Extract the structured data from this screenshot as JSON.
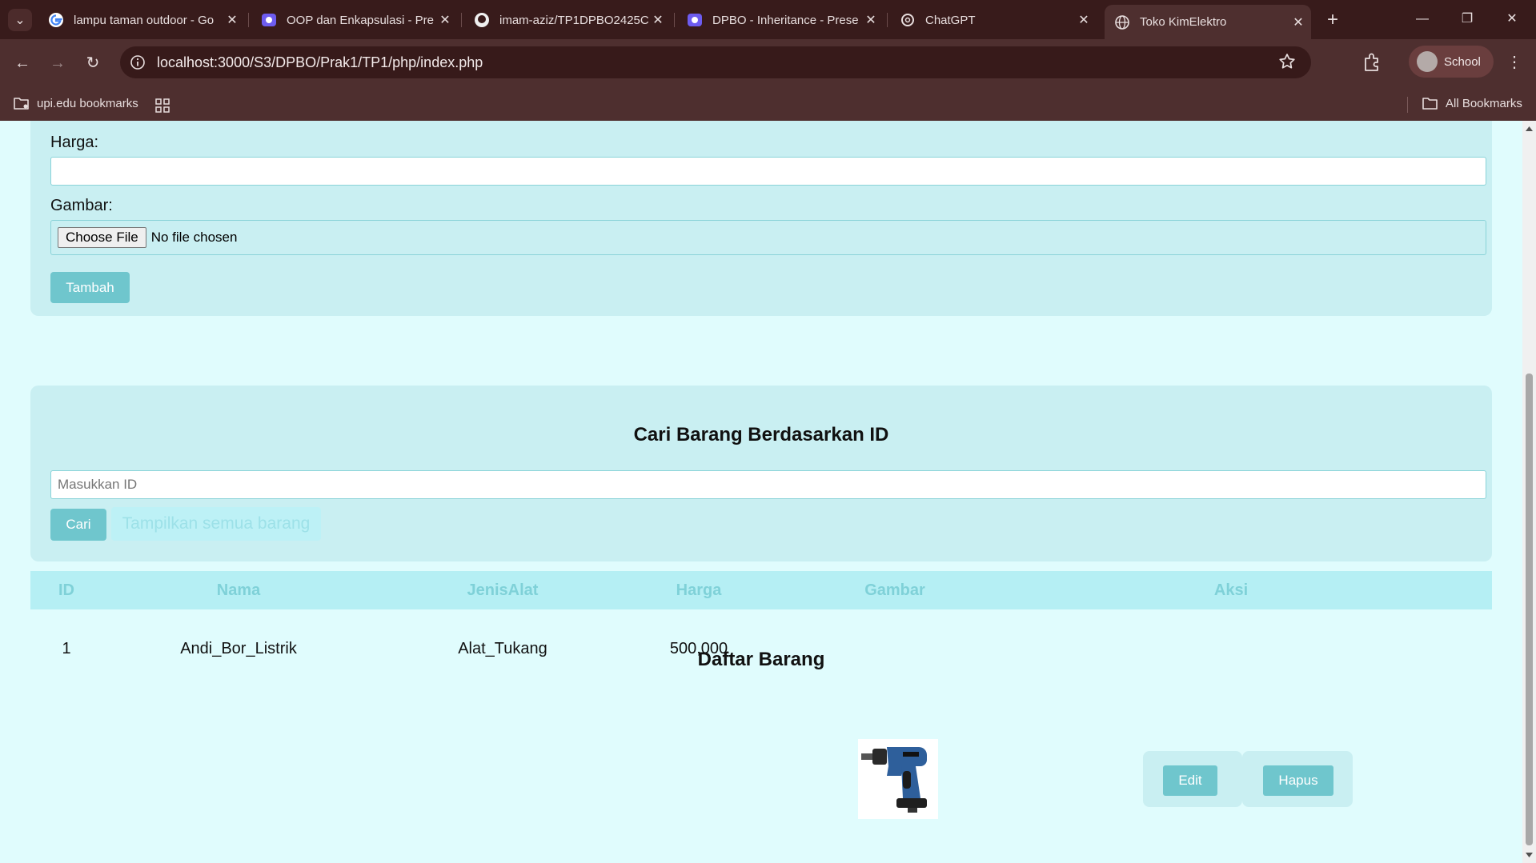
{
  "browser": {
    "tabs": [
      {
        "title": "lampu taman outdoor - Go",
        "icon": "google-icon",
        "active": false
      },
      {
        "title": "OOP dan Enkapsulasi - Pre",
        "icon": "presentation-icon",
        "active": false
      },
      {
        "title": "imam-aziz/TP1DPBO2425C",
        "icon": "github-icon",
        "active": false
      },
      {
        "title": "DPBO - Inheritance - Prese",
        "icon": "presentation-icon",
        "active": false
      },
      {
        "title": "ChatGPT",
        "icon": "chatgpt-icon",
        "active": false
      },
      {
        "title": "Toko KimElektro",
        "icon": "globe-icon",
        "active": true
      }
    ],
    "url": "localhost:3000/S3/DPBO/Prak1/TP1/php/index.php",
    "profile_label": "School",
    "bookmarks_left": "upi.edu bookmarks",
    "bookmarks_right": "All Bookmarks",
    "tab_close_glyph": "✕",
    "new_tab_glyph": "+",
    "minimize_glyph": "—",
    "restore_glyph": "❐",
    "close_glyph": "✕",
    "back_glyph": "←",
    "forward_glyph": "→",
    "reload_glyph": "↻",
    "menu_glyph": "⋮",
    "tab_menu_glyph": "⌄"
  },
  "form": {
    "harga_label": "Harga:",
    "harga_value": "",
    "gambar_label": "Gambar:",
    "file_button": "Choose File",
    "file_status": "No file chosen",
    "submit_label": "Tambah"
  },
  "search": {
    "title": "Cari Barang Berdasarkan ID",
    "placeholder": "Masukkan ID",
    "search_button": "Cari",
    "show_all_button": "Tampilkan semua barang"
  },
  "list": {
    "title": "Daftar Barang",
    "columns": [
      "ID",
      "Nama",
      "JenisAlat",
      "Harga",
      "Gambar",
      "Aksi"
    ],
    "rows": [
      {
        "id": "1",
        "nama": "Andi_Bor_Listrik",
        "jenis": "Alat_Tukang",
        "harga": "500,000",
        "gambar": "power-drill-image",
        "edit": "Edit",
        "hapus": "Hapus"
      }
    ]
  },
  "colors": {
    "accent": "#6fc6cd",
    "page_bg": "#e0fcfd",
    "card_bg": "#c9eff2",
    "header_bg": "#b5eff4"
  }
}
